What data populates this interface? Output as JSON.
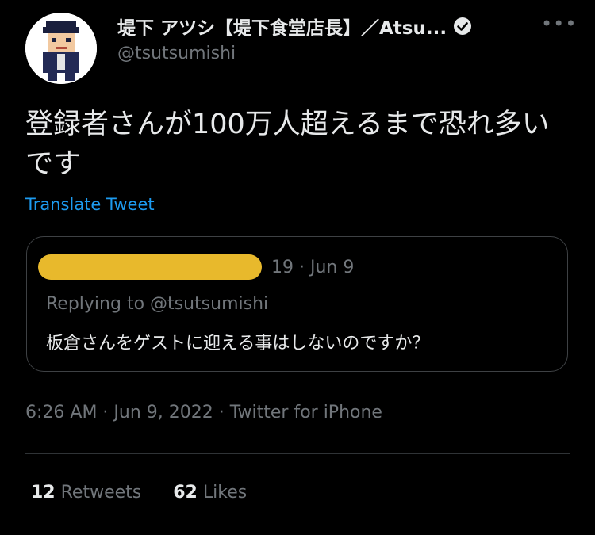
{
  "author": {
    "display_name": "堤下 アツシ【堤下食堂店長】／Atsu...",
    "handle": "@tsutsumishi",
    "avatar_icon": "pixel-character-avatar",
    "verified_icon": "verified-badge-icon"
  },
  "more_label": "•••",
  "tweet": {
    "text": "登録者さんが100万人超えるまで恐れ多いです",
    "translate_label": "Translate Tweet",
    "timestamp": "6:26 AM · Jun 9, 2022 · Twitter for iPhone"
  },
  "quoted_tweet": {
    "date": "19 · Jun 9",
    "replying_to": "Replying to @tsutsumishi",
    "text": "板倉さんをゲストに迎える事はしないのですか？"
  },
  "stats": {
    "retweets_count": "12",
    "retweets_label": "Retweets",
    "likes_count": "62",
    "likes_label": "Likes"
  },
  "colors": {
    "background": "#000000",
    "primary_text": "#e7e9ea",
    "secondary_text": "#71767b",
    "link": "#1d9bf0",
    "redaction": "#e8b92c"
  }
}
